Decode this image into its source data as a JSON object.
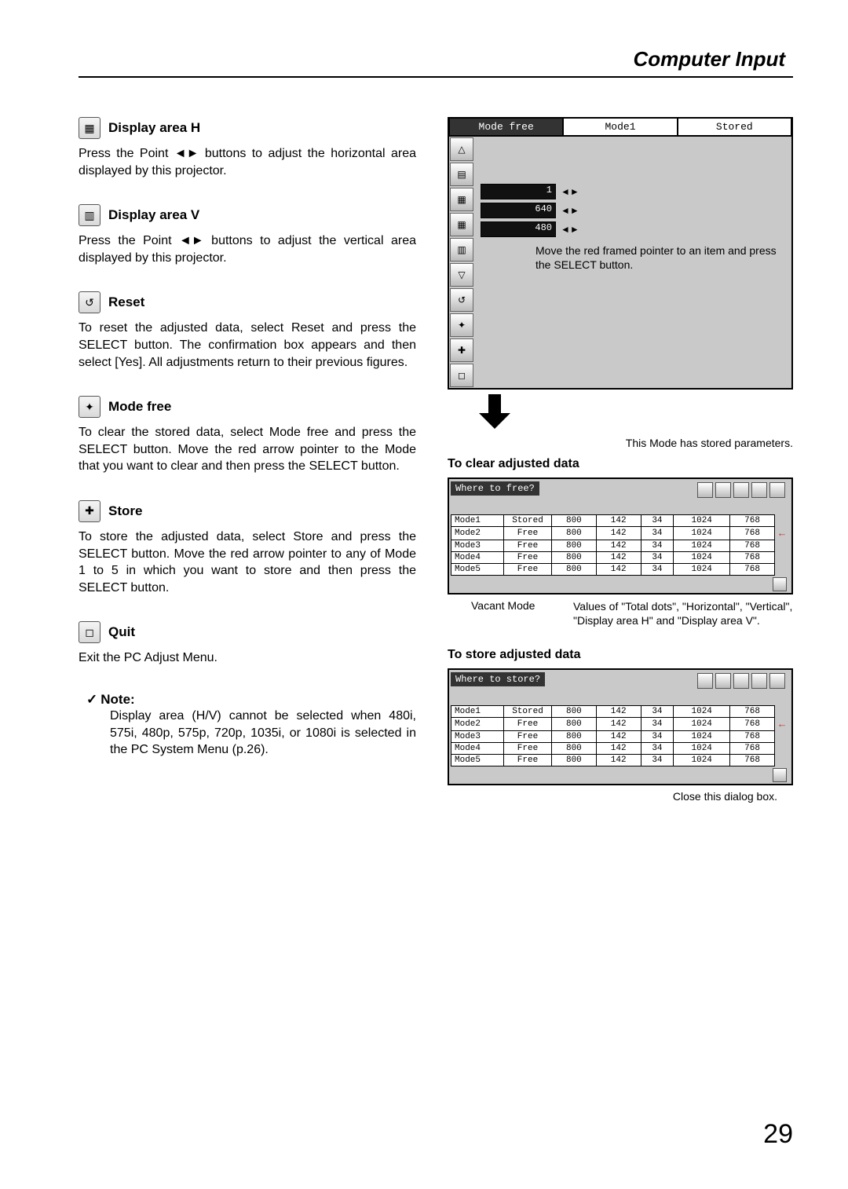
{
  "header": {
    "section_title": "Computer Input"
  },
  "left": {
    "display_area_h": {
      "title": "Display area H",
      "icon": "display-h-icon",
      "body": "Press the Point ◄► buttons to adjust the horizontal area displayed by this projector."
    },
    "display_area_v": {
      "title": "Display area V",
      "icon": "display-v-icon",
      "body": "Press the Point ◄► buttons to adjust the vertical area displayed by this projector."
    },
    "reset": {
      "title": "Reset",
      "icon": "reset-icon",
      "body": "To reset the adjusted data, select Reset and press the SELECT button.  The confirmation box appears and then select [Yes].  All adjustments return to their previous figures."
    },
    "mode_free": {
      "title": "Mode free",
      "icon": "mode-free-icon",
      "body": "To clear the stored data, select Mode free and press the SELECT button.  Move the red arrow pointer to the Mode that you want to clear and then press the SELECT button."
    },
    "store": {
      "title": "Store",
      "icon": "store-icon",
      "body": "To store the adjusted data, select Store and press the SELECT button.  Move the red arrow pointer to any of Mode 1 to 5 in which you want to store and then press the SELECT button."
    },
    "quit": {
      "title": "Quit",
      "icon": "quit-icon",
      "body": "Exit the PC Adjust Menu."
    },
    "note": {
      "label": "Note:",
      "check": "✓",
      "body": "Display area (H/V) cannot be selected when 480i, 575i, 480p, 575p, 720p, 1035i, or 1080i is selected in the PC System Menu (p.26)."
    }
  },
  "right": {
    "top_ui": {
      "tabs": [
        "Mode free",
        "Mode1",
        "Stored"
      ],
      "values": [
        "1",
        "640",
        "480"
      ],
      "callout": "Move the red framed pointer to an item and press the SELECT button.",
      "stored_note": "This Mode has stored parameters."
    },
    "clear": {
      "heading": "To clear adjusted data",
      "table_title": "Where to free?",
      "rows": [
        {
          "name": "Mode1",
          "status": "Stored",
          "d": [
            "800",
            "142",
            "34",
            "1024",
            "768"
          ],
          "arrow": false
        },
        {
          "name": "Mode2",
          "status": "Free",
          "d": [
            "800",
            "142",
            "34",
            "1024",
            "768"
          ],
          "arrow": true
        },
        {
          "name": "Mode3",
          "status": "Free",
          "d": [
            "800",
            "142",
            "34",
            "1024",
            "768"
          ],
          "arrow": false
        },
        {
          "name": "Mode4",
          "status": "Free",
          "d": [
            "800",
            "142",
            "34",
            "1024",
            "768"
          ],
          "arrow": false
        },
        {
          "name": "Mode5",
          "status": "Free",
          "d": [
            "800",
            "142",
            "34",
            "1024",
            "768"
          ],
          "arrow": false
        }
      ],
      "callout_left": "Vacant Mode",
      "callout_right": "Values of \"Total dots\", \"Horizontal\", \"Vertical\", \"Display area H\" and \"Display area V\"."
    },
    "store": {
      "heading": "To store adjusted data",
      "table_title": "Where to store?",
      "rows": [
        {
          "name": "Mode1",
          "status": "Stored",
          "d": [
            "800",
            "142",
            "34",
            "1024",
            "768"
          ],
          "arrow": false
        },
        {
          "name": "Mode2",
          "status": "Free",
          "d": [
            "800",
            "142",
            "34",
            "1024",
            "768"
          ],
          "arrow": true
        },
        {
          "name": "Mode3",
          "status": "Free",
          "d": [
            "800",
            "142",
            "34",
            "1024",
            "768"
          ],
          "arrow": false
        },
        {
          "name": "Mode4",
          "status": "Free",
          "d": [
            "800",
            "142",
            "34",
            "1024",
            "768"
          ],
          "arrow": false
        },
        {
          "name": "Mode5",
          "status": "Free",
          "d": [
            "800",
            "142",
            "34",
            "1024",
            "768"
          ],
          "arrow": false
        }
      ],
      "close_caption": "Close this dialog box."
    }
  },
  "page_number": "29"
}
